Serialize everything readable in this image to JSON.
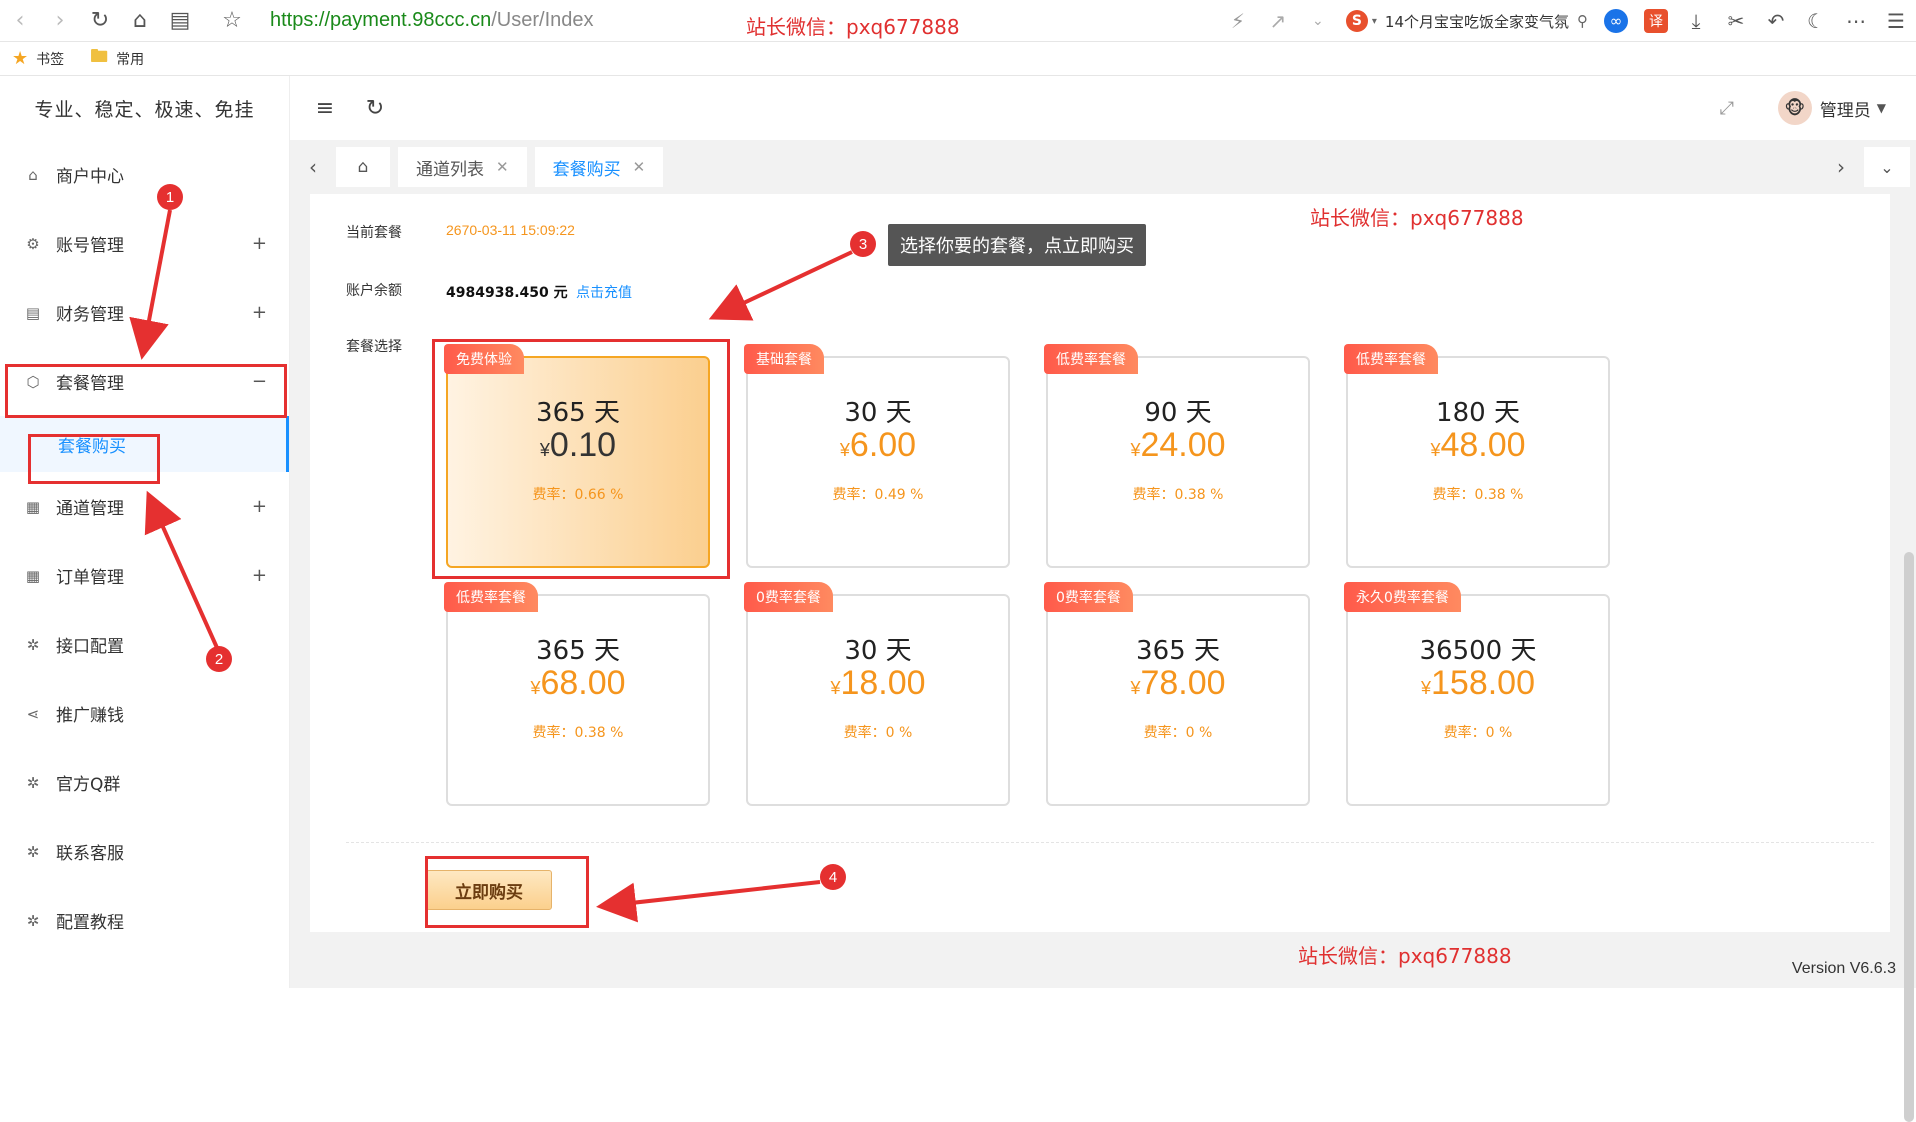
{
  "browser": {
    "url_proto": "https://",
    "url_host": "payment.98ccc.cn",
    "url_path": "/User/Index",
    "search_text": "14个月宝宝吃饭全家变气氛",
    "translate_label": "译",
    "sogou_label": "S",
    "bookmarks": [
      "书签",
      "常用"
    ]
  },
  "watermarks": {
    "top": "站长微信：pxq677888",
    "right": "站长微信：pxq677888",
    "bottom": "站长微信：pxq677888"
  },
  "sidebar": {
    "brand": "专业、稳定、极速、免挂",
    "items": [
      {
        "label": "商户中心",
        "icon": "home-icon",
        "expandable": false
      },
      {
        "label": "账号管理",
        "icon": "gear-icon",
        "expandable": true
      },
      {
        "label": "财务管理",
        "icon": "finance-icon",
        "expandable": true
      },
      {
        "label": "套餐管理",
        "icon": "box-icon",
        "expandable": true,
        "expanded": true
      },
      {
        "label": "通道管理",
        "icon": "grid-icon",
        "expandable": true
      },
      {
        "label": "订单管理",
        "icon": "grid-icon",
        "expandable": true
      },
      {
        "label": "接口配置",
        "icon": "plugin-icon",
        "expandable": false
      },
      {
        "label": "推广赚钱",
        "icon": "share-icon",
        "expandable": false
      },
      {
        "label": "官方Q群",
        "icon": "plugin-icon",
        "expandable": false
      },
      {
        "label": "联系客服",
        "icon": "plugin-icon",
        "expandable": false
      },
      {
        "label": "配置教程",
        "icon": "plugin-icon",
        "expandable": false
      }
    ],
    "submenu": "套餐购买",
    "plus": "+",
    "minus": "−"
  },
  "header": {
    "user": "管理员"
  },
  "tabs": [
    {
      "label": "通道列表",
      "active": false
    },
    {
      "label": "套餐购买",
      "active": true
    }
  ],
  "info": {
    "current_label": "当前套餐",
    "current_value": "2670-03-11 15:09:22",
    "balance_label": "账户余额",
    "balance_value": "4984938.450 元",
    "recharge_link": "点击充值",
    "select_label": "套餐选择"
  },
  "currency": "¥",
  "packages": [
    {
      "tag": "免费体验",
      "days": "365 天",
      "price": "0.10",
      "rate": "费率：0.66 %",
      "selected": true
    },
    {
      "tag": "基础套餐",
      "days": "30 天",
      "price": "6.00",
      "rate": "费率：0.49 %",
      "selected": false
    },
    {
      "tag": "低费率套餐",
      "days": "90 天",
      "price": "24.00",
      "rate": "费率：0.38 %",
      "selected": false
    },
    {
      "tag": "低费率套餐",
      "days": "180 天",
      "price": "48.00",
      "rate": "费率：0.38 %",
      "selected": false
    },
    {
      "tag": "低费率套餐",
      "days": "365 天",
      "price": "68.00",
      "rate": "费率：0.38 %",
      "selected": false
    },
    {
      "tag": "0费率套餐",
      "days": "30 天",
      "price": "18.00",
      "rate": "费率：0 %",
      "selected": false
    },
    {
      "tag": "0费率套餐",
      "days": "365 天",
      "price": "78.00",
      "rate": "费率：0 %",
      "selected": false
    },
    {
      "tag": "永久0费率套餐",
      "days": "36500 天",
      "price": "158.00",
      "rate": "费率：0 %",
      "selected": false
    }
  ],
  "buy_button": "立即购买",
  "version": "Version V6.6.3",
  "annotations": {
    "tooltip": "选择你要的套餐，点立即购买",
    "badges": [
      "1",
      "2",
      "3",
      "4"
    ]
  },
  "colors": {
    "accent": "#1890ff",
    "price": "#f5951d",
    "highlight": "#e53030"
  }
}
